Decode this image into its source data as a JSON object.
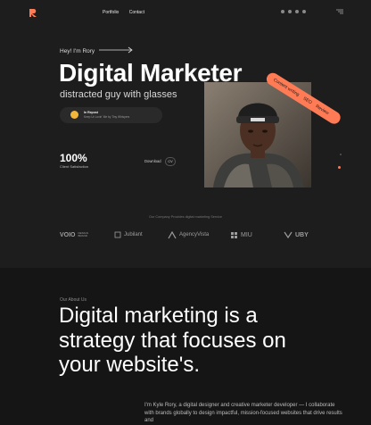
{
  "nav": {
    "logo_letter": "R",
    "links": [
      "Portfolio",
      "Contact"
    ],
    "socials": [
      "facebook-icon",
      "twitter-icon",
      "dribbble-icon",
      "x-icon"
    ],
    "menu_icon": "menu-icon"
  },
  "hero": {
    "greeting": "Hey! I'm Rory",
    "title": "Digital Marketer",
    "subtitle": "distracted guy with glasses",
    "repost": {
      "title": "In Repost",
      "text": "Keep Ur Lovin' Me by Tiny Whispers"
    },
    "stat_value": "100%",
    "stat_label": "Client Satisfaction",
    "download_label": "Download",
    "cv_label": "CV",
    "ribbon_items": [
      "Content writing",
      "SEO",
      "Review"
    ]
  },
  "brands": {
    "caption": "Our Company Provides digital marketing Service",
    "items": [
      "VOIO",
      "DESIGN BRAND",
      "Jubilant",
      "AgencyVista",
      "MIU",
      "UBY"
    ]
  },
  "about": {
    "kicker": "Our About Us",
    "heading": "Digital marketing is a strategy that focuses on your website's.",
    "bio": "I'm Kyle Rory, a digital designer and creative marketer developer — I collaborate with brands globally to design impactful, mission-focused websites that drive results and"
  },
  "colors": {
    "accent": "#ff7b55",
    "background": "#151515",
    "hero_background": "#1d1d1d"
  }
}
